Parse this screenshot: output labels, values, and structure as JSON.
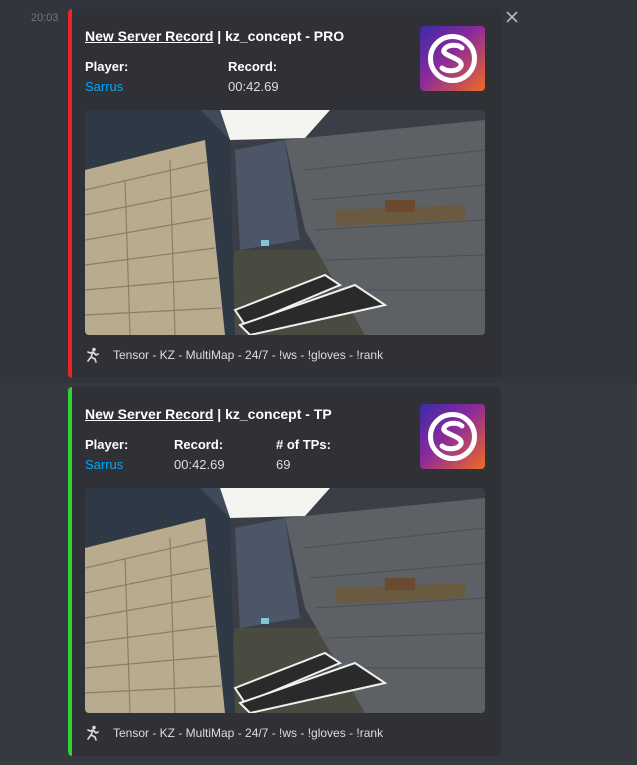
{
  "messages": [
    {
      "timestamp": "20:03",
      "embed": {
        "title_link": "New Server Record",
        "title_rest": " | kz_concept - PRO",
        "accent_color": "#e8262b",
        "fields": [
          {
            "name": "Player:",
            "value": "Sarrus"
          },
          {
            "name": "Record:",
            "value": "00:42.69"
          }
        ],
        "footer": "Tensor - KZ - MultiMap - 24/7 - !ws - !gloves - !rank"
      }
    },
    {
      "embed": {
        "title_link": "New Server Record",
        "title_rest": " | kz_concept - TP",
        "accent_color": "#2dd62d",
        "fields": [
          {
            "name": "Player:",
            "value": "Sarrus"
          },
          {
            "name": "Record:",
            "value": "00:42.69"
          },
          {
            "name": "# of TPs:",
            "value": "69"
          }
        ],
        "footer": "Tensor - KZ - MultiMap - 24/7 - !ws - !gloves - !rank"
      }
    }
  ],
  "icons": {
    "close": "close-icon",
    "thumbnail": "server-logo-icon",
    "footer": "runner-icon"
  }
}
